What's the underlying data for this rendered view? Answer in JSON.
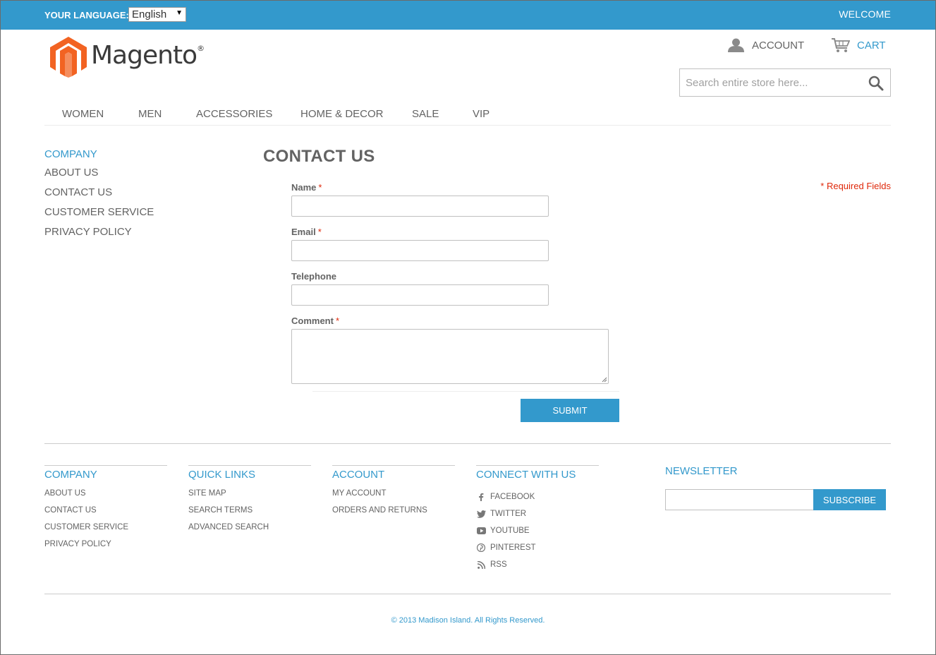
{
  "topbar": {
    "language_label": "YOUR LANGUAGE:",
    "language_selected": "English",
    "welcome": "WELCOME"
  },
  "header": {
    "logo_text": "Magento",
    "logo_reg": "®",
    "account_label": "ACCOUNT",
    "cart_label": "CART",
    "search_placeholder": "Search entire store here..."
  },
  "nav": {
    "items": [
      "WOMEN",
      "MEN",
      "ACCESSORIES",
      "HOME & DECOR",
      "SALE",
      "VIP"
    ]
  },
  "sidebar": {
    "title": "COMPANY",
    "links": [
      "ABOUT US",
      "CONTACT US",
      "CUSTOMER SERVICE",
      "PRIVACY POLICY"
    ]
  },
  "main": {
    "title": "CONTACT US",
    "required_note": "* Required Fields",
    "fields": {
      "name": {
        "label": "Name",
        "required": "*",
        "value": ""
      },
      "email": {
        "label": "Email",
        "required": "*",
        "value": ""
      },
      "telephone": {
        "label": "Telephone",
        "value": ""
      },
      "comment": {
        "label": "Comment",
        "required": "*",
        "value": ""
      }
    },
    "submit_label": "SUBMIT"
  },
  "footer": {
    "company": {
      "title": "COMPANY",
      "links": [
        "ABOUT US",
        "CONTACT US",
        "CUSTOMER SERVICE",
        "PRIVACY POLICY"
      ]
    },
    "quick_links": {
      "title": "QUICK LINKS",
      "links": [
        "SITE MAP",
        "SEARCH TERMS",
        "ADVANCED SEARCH"
      ]
    },
    "account": {
      "title": "ACCOUNT",
      "links": [
        "MY ACCOUNT",
        "ORDERS AND RETURNS"
      ]
    },
    "connect": {
      "title": "CONNECT WITH US",
      "links": [
        {
          "label": "FACEBOOK",
          "icon": "facebook-icon"
        },
        {
          "label": "TWITTER",
          "icon": "twitter-icon"
        },
        {
          "label": "YOUTUBE",
          "icon": "youtube-icon"
        },
        {
          "label": "PINTEREST",
          "icon": "pinterest-icon"
        },
        {
          "label": "RSS",
          "icon": "rss-icon"
        }
      ]
    },
    "newsletter": {
      "title": "NEWSLETTER",
      "subscribe_label": "SUBSCRIBE"
    },
    "copyright": "© 2013 Madison Island. All Rights Reserved."
  },
  "colors": {
    "accent": "#3399cc",
    "text": "#636363",
    "required": "#df280a",
    "logo_orange": "#f26322"
  }
}
